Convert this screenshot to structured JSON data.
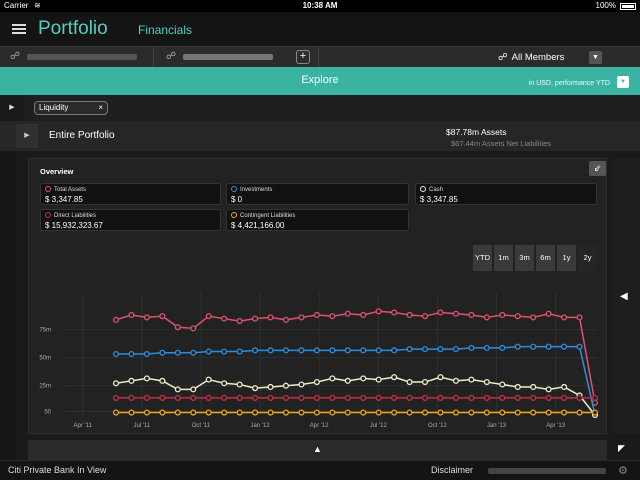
{
  "status_bar": {
    "carrier": "Carrier",
    "time": "10:38 AM",
    "battery": "100%"
  },
  "header": {
    "title": "Portfolio",
    "subtitle": "Financials",
    "menu_icon": "menu-icon"
  },
  "client_bar": {
    "add_label": "+",
    "members_label": "All Members",
    "members_icon": "people-icon"
  },
  "explore": {
    "label": "Explore",
    "currency_note": "in USD, performance YTD"
  },
  "filter": {
    "chip_label": "Liquidity",
    "chip_close": "×"
  },
  "portfolio": {
    "name": "Entire Portfolio",
    "assets": "$87.78m Assets",
    "net": "$67.44m Assets Net Liabilities"
  },
  "overview": {
    "title": "Overview",
    "cards": [
      {
        "label": "Total Assets",
        "value": "$ 3,347.85",
        "color": "#e0516f"
      },
      {
        "label": "Investments",
        "value": "$ 0",
        "color": "#2a8fe0"
      },
      {
        "label": "Cash",
        "value": "$ 3,347.85",
        "color": "#eeeecc"
      },
      {
        "label": "Direct Liabilities",
        "value": "$ 15,932,323.67",
        "color": "#c0304a"
      },
      {
        "label": "Contingent Liabilities",
        "value": "$ 4,421,166.00",
        "color": "#f0a818"
      }
    ],
    "ranges": [
      "YTD",
      "1m",
      "3m",
      "6m",
      "1y",
      "2y"
    ],
    "active_range": "2y"
  },
  "chart_data": {
    "type": "line",
    "x_labels": [
      "Apr '11",
      "Jul '11",
      "Oct '11",
      "Jan '12",
      "Apr '12",
      "Jul '12",
      "Oct '12",
      "Jan '13",
      "Apr '13"
    ],
    "y_ticks": [
      "50",
      "25m",
      "50m",
      "75m"
    ],
    "ylim": [
      0,
      100
    ],
    "grid": true,
    "series": [
      {
        "color": "#e0516f",
        "values": [
          78,
          82,
          80,
          81,
          72,
          71,
          81,
          79,
          77,
          79,
          80,
          78,
          80,
          82,
          81,
          83,
          82,
          85,
          84,
          82,
          81,
          84,
          83,
          82,
          80,
          82,
          81,
          80,
          83,
          80,
          80,
          10
        ]
      },
      {
        "color": "#2a8fe0",
        "values": [
          50,
          50,
          50,
          51,
          51,
          51,
          52,
          52,
          52,
          53,
          53,
          53,
          53,
          53,
          53,
          53,
          53,
          53,
          53,
          54,
          54,
          54,
          54,
          55,
          55,
          55,
          56,
          56,
          56,
          56,
          56,
          0
        ]
      },
      {
        "color": "#eeeecc",
        "values": [
          26,
          28,
          30,
          28,
          21,
          21,
          29,
          26,
          25,
          22,
          23,
          24,
          25,
          27,
          30,
          28,
          30,
          29,
          31,
          27,
          27,
          31,
          28,
          29,
          27,
          25,
          23,
          23,
          21,
          23,
          16,
          0
        ]
      },
      {
        "color": "#c0304a",
        "values": [
          14,
          14,
          14,
          14,
          14,
          14,
          14,
          14,
          14,
          14,
          14,
          14,
          14,
          14,
          14,
          14,
          14,
          14,
          14,
          14,
          14,
          14,
          14,
          14,
          14,
          14,
          14,
          14,
          14,
          14,
          14,
          14
        ]
      },
      {
        "color": "#f0a818",
        "values": [
          2,
          2,
          2,
          2,
          2,
          2,
          2,
          2,
          2,
          2,
          2,
          2,
          2,
          2,
          2,
          2,
          2,
          2,
          2,
          2,
          2,
          2,
          2,
          2,
          2,
          2,
          2,
          2,
          2,
          2,
          2,
          2
        ]
      }
    ]
  },
  "bottom": {
    "up_arrow": "▲"
  },
  "footer": {
    "brand": "Citi Private Bank In View",
    "disclaimer": "Disclaimer",
    "gear_icon": "gear-icon"
  }
}
